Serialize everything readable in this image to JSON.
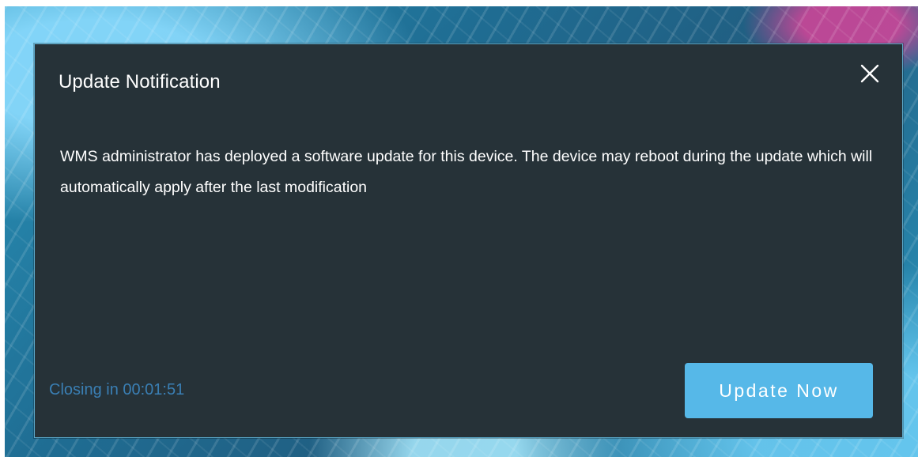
{
  "dialog": {
    "title": "Update Notification",
    "message": "WMS administrator has deployed a software update for this device. The device may reboot during the update which will automatically apply after the last modification",
    "close_icon": "close-icon",
    "countdown_text": "Closing in 00:01:51",
    "update_button_label": "Update Now"
  },
  "colors": {
    "dialog_background": "#263238",
    "dialog_border": "#5ba8c9",
    "accent_button": "#56b8e8",
    "countdown_text": "#3a7fb4",
    "text_primary": "#ffffff"
  }
}
